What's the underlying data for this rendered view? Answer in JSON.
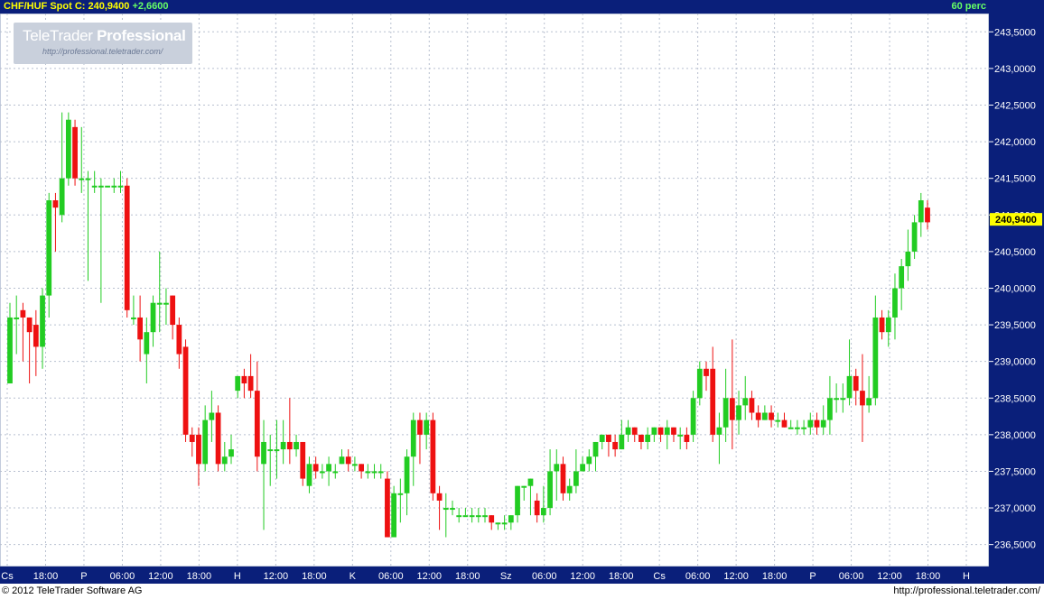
{
  "header": {
    "symbol": "CHF/HUF Spot",
    "close_label": "C:",
    "close_value": "240,9400",
    "change": "+2,6600",
    "period": "60 perc"
  },
  "watermark": {
    "brand_a": "TeleTrader",
    "brand_b": "Professional",
    "url": "http://professional.teletrader.com/"
  },
  "footer": {
    "copyright": "© 2012 TeleTrader Software AG",
    "url": "http://professional.teletrader.com/"
  },
  "colors": {
    "up": "#22cc22",
    "down": "#ee1111",
    "flat": "#22cccc",
    "header_bg": "#0a1f7a",
    "axis_bg": "#0a1f7a",
    "last_price_bg": "#ffff00"
  },
  "chart_data": {
    "type": "candlestick",
    "title": "CHF/HUF Spot",
    "y_range": [
      236.2,
      243.75
    ],
    "y_ticks": [
      "243,5000",
      "243,0000",
      "242,5000",
      "242,0000",
      "241,5000",
      "241,0000",
      "240,5000",
      "240,0000",
      "239,5000",
      "239,0000",
      "238,5000",
      "238,0000",
      "237,5000",
      "237,0000",
      "236,5000"
    ],
    "last_price_label": "240,9400",
    "last_price": 240.94,
    "x_ticks": [
      "Cs",
      "18:00",
      "P",
      "06:00",
      "12:00",
      "18:00",
      "H",
      "12:00",
      "18:00",
      "K",
      "06:00",
      "12:00",
      "18:00",
      "Sz",
      "06:00",
      "12:00",
      "18:00",
      "Cs",
      "06:00",
      "12:00",
      "18:00",
      "P",
      "06:00",
      "12:00",
      "18:00",
      "H"
    ],
    "grid": true,
    "candles": [
      [
        238.7,
        239.6,
        239.8,
        238.7
      ],
      [
        239.6,
        239.6,
        239.9,
        239.1
      ],
      [
        239.7,
        239.6,
        239.8,
        239.0
      ],
      [
        239.6,
        239.4,
        239.6,
        238.7
      ],
      [
        239.5,
        239.2,
        239.7,
        238.8
      ],
      [
        239.2,
        239.9,
        240.0,
        238.9
      ],
      [
        239.9,
        241.2,
        241.3,
        239.6
      ],
      [
        241.2,
        241.1,
        241.3,
        240.5
      ],
      [
        241.0,
        241.5,
        242.4,
        240.9
      ],
      [
        241.5,
        242.3,
        242.4,
        241.4
      ],
      [
        242.2,
        241.5,
        242.3,
        241.4
      ],
      [
        241.5,
        241.5,
        242.2,
        241.3
      ],
      [
        241.5,
        241.5,
        241.6,
        240.1
      ],
      [
        241.4,
        241.4,
        241.6,
        241.3
      ],
      [
        241.4,
        241.4,
        241.5,
        239.8
      ],
      [
        241.4,
        241.4,
        241.4,
        241.4
      ],
      [
        241.4,
        241.4,
        241.5,
        241.3
      ],
      [
        241.4,
        241.4,
        241.6,
        241.3
      ],
      [
        241.4,
        239.7,
        241.5,
        239.6
      ],
      [
        239.6,
        239.6,
        239.9,
        239.5
      ],
      [
        239.6,
        239.3,
        239.9,
        239.0
      ],
      [
        239.1,
        239.4,
        239.6,
        238.7
      ],
      [
        239.4,
        239.8,
        239.9,
        239.2
      ],
      [
        239.8,
        239.8,
        240.5,
        239.4
      ],
      [
        239.8,
        239.8,
        240.0,
        239.5
      ],
      [
        239.9,
        239.5,
        239.9,
        239.3
      ],
      [
        239.5,
        239.1,
        239.6,
        238.9
      ],
      [
        239.2,
        238.0,
        239.3,
        237.9
      ],
      [
        238.0,
        237.9,
        238.1,
        237.7
      ],
      [
        238.0,
        237.6,
        238.1,
        237.3
      ],
      [
        237.6,
        238.2,
        238.4,
        237.5
      ],
      [
        238.2,
        238.3,
        238.6,
        237.9
      ],
      [
        238.3,
        237.6,
        238.4,
        237.5
      ],
      [
        237.6,
        237.7,
        237.9,
        237.5
      ],
      [
        237.7,
        237.8,
        238.0,
        237.6
      ],
      [
        238.6,
        238.8,
        238.8,
        238.5
      ],
      [
        238.8,
        238.7,
        238.9,
        238.5
      ],
      [
        238.8,
        238.6,
        239.1,
        238.5
      ],
      [
        238.6,
        237.7,
        239.0,
        237.5
      ],
      [
        237.6,
        237.9,
        238.2,
        236.7
      ],
      [
        237.8,
        237.8,
        238.0,
        237.3
      ],
      [
        237.8,
        237.8,
        238.2,
        237.4
      ],
      [
        237.8,
        237.9,
        238.2,
        237.6
      ],
      [
        237.9,
        237.8,
        238.5,
        237.6
      ],
      [
        237.8,
        237.9,
        238.0,
        237.7
      ],
      [
        237.9,
        237.4,
        237.9,
        237.3
      ],
      [
        237.3,
        237.6,
        237.7,
        237.2
      ],
      [
        237.6,
        237.5,
        237.7,
        237.4
      ],
      [
        237.5,
        237.5,
        237.6,
        237.4
      ],
      [
        237.5,
        237.6,
        237.7,
        237.3
      ],
      [
        237.5,
        237.5,
        237.6,
        237.4
      ],
      [
        237.6,
        237.7,
        237.8,
        237.6
      ],
      [
        237.7,
        237.6,
        237.8,
        237.5
      ],
      [
        237.6,
        237.6,
        237.7,
        237.5
      ],
      [
        237.6,
        237.5,
        237.6,
        237.4
      ],
      [
        237.5,
        237.5,
        237.6,
        237.4
      ],
      [
        237.5,
        237.5,
        237.6,
        237.4
      ],
      [
        237.5,
        237.5,
        237.6,
        237.4
      ],
      [
        237.4,
        236.6,
        237.5,
        236.6
      ],
      [
        236.6,
        237.2,
        237.3,
        236.6
      ],
      [
        237.2,
        237.2,
        237.4,
        236.8
      ],
      [
        237.2,
        237.7,
        237.8,
        236.9
      ],
      [
        237.7,
        238.2,
        238.3,
        237.3
      ],
      [
        238.2,
        238.0,
        238.3,
        237.6
      ],
      [
        238.0,
        238.2,
        238.3,
        237.8
      ],
      [
        238.2,
        237.2,
        238.3,
        237.1
      ],
      [
        237.2,
        237.1,
        237.3,
        236.7
      ],
      [
        237.0,
        237.0,
        237.2,
        236.6
      ],
      [
        237.0,
        237.0,
        237.1,
        236.9
      ],
      [
        236.9,
        236.9,
        237.0,
        236.8
      ],
      [
        236.9,
        236.9,
        237.0,
        236.9
      ],
      [
        236.9,
        236.9,
        237.0,
        236.8
      ],
      [
        236.9,
        236.9,
        237.0,
        236.8
      ],
      [
        236.9,
        236.9,
        237.0,
        236.8
      ],
      [
        236.9,
        236.8,
        236.9,
        236.7
      ],
      [
        236.8,
        236.8,
        236.8,
        236.7
      ],
      [
        236.8,
        236.8,
        236.9,
        236.7
      ],
      [
        236.8,
        236.9,
        236.9,
        236.7
      ],
      [
        236.9,
        237.3,
        237.3,
        236.8
      ],
      [
        237.3,
        237.3,
        237.3,
        237.1
      ],
      [
        237.3,
        237.4,
        237.4,
        236.9
      ],
      [
        237.1,
        236.9,
        237.2,
        236.8
      ],
      [
        236.9,
        237.0,
        237.3,
        236.8
      ],
      [
        237.0,
        237.5,
        237.8,
        236.9
      ],
      [
        237.5,
        237.6,
        237.8,
        237.1
      ],
      [
        237.6,
        237.2,
        237.7,
        237.1
      ],
      [
        237.2,
        237.3,
        237.4,
        237.1
      ],
      [
        237.3,
        237.5,
        237.8,
        237.2
      ],
      [
        237.5,
        237.6,
        237.7,
        237.5
      ],
      [
        237.6,
        237.7,
        237.8,
        237.5
      ],
      [
        237.7,
        237.9,
        237.9,
        237.5
      ],
      [
        237.9,
        238.0,
        238.0,
        237.8
      ],
      [
        238.0,
        237.9,
        238.0,
        237.7
      ],
      [
        237.9,
        237.8,
        238.0,
        237.7
      ],
      [
        237.8,
        238.0,
        238.2,
        237.8
      ],
      [
        238.0,
        238.1,
        238.2,
        237.9
      ],
      [
        238.1,
        238.0,
        238.1,
        237.9
      ],
      [
        238.0,
        237.9,
        238.0,
        237.8
      ],
      [
        237.9,
        238.0,
        238.1,
        237.8
      ],
      [
        238.0,
        238.1,
        238.1,
        237.9
      ],
      [
        238.1,
        238.0,
        238.1,
        237.9
      ],
      [
        238.0,
        238.1,
        238.2,
        237.8
      ],
      [
        238.1,
        238.0,
        238.1,
        237.9
      ],
      [
        238.0,
        238.0,
        238.1,
        237.8
      ],
      [
        238.0,
        237.9,
        238.1,
        237.8
      ],
      [
        238.0,
        238.5,
        238.6,
        237.9
      ],
      [
        238.5,
        238.9,
        239.0,
        238.4
      ],
      [
        238.9,
        238.8,
        239.0,
        238.6
      ],
      [
        238.9,
        238.0,
        239.2,
        237.9
      ],
      [
        238.0,
        238.1,
        238.3,
        237.6
      ],
      [
        238.1,
        238.5,
        238.9,
        237.9
      ],
      [
        238.5,
        238.2,
        239.3,
        237.8
      ],
      [
        238.2,
        238.4,
        238.6,
        238.0
      ],
      [
        238.4,
        238.5,
        238.8,
        238.2
      ],
      [
        238.5,
        238.3,
        238.6,
        238.2
      ],
      [
        238.3,
        238.2,
        238.4,
        238.1
      ],
      [
        238.2,
        238.3,
        238.4,
        238.2
      ],
      [
        238.3,
        238.2,
        238.4,
        238.1
      ],
      [
        238.2,
        238.2,
        238.3,
        238.1
      ],
      [
        238.2,
        238.1,
        238.3,
        238.1
      ],
      [
        238.1,
        238.1,
        238.2,
        238.1
      ],
      [
        238.1,
        238.1,
        238.2,
        238.0
      ],
      [
        238.1,
        238.1,
        238.2,
        238.0
      ],
      [
        238.1,
        238.2,
        238.3,
        238.0
      ],
      [
        238.2,
        238.1,
        238.3,
        238.0
      ],
      [
        238.1,
        238.2,
        238.4,
        238.0
      ],
      [
        238.2,
        238.5,
        238.8,
        238.0
      ],
      [
        238.5,
        238.5,
        238.7,
        238.3
      ],
      [
        238.5,
        238.5,
        238.7,
        238.3
      ],
      [
        238.5,
        238.8,
        239.3,
        238.4
      ],
      [
        238.8,
        238.6,
        238.9,
        238.4
      ],
      [
        238.6,
        238.4,
        239.1,
        237.9
      ],
      [
        238.4,
        238.5,
        238.8,
        238.3
      ],
      [
        238.5,
        239.6,
        239.9,
        238.4
      ],
      [
        239.6,
        239.4,
        239.7,
        239.3
      ],
      [
        239.4,
        239.6,
        239.7,
        239.2
      ],
      [
        239.6,
        240.0,
        240.2,
        239.3
      ],
      [
        240.0,
        240.3,
        240.4,
        239.7
      ],
      [
        240.3,
        240.5,
        240.8,
        240.1
      ],
      [
        240.5,
        240.9,
        241.0,
        240.4
      ],
      [
        240.9,
        241.2,
        241.3,
        240.7
      ],
      [
        241.1,
        240.9,
        241.2,
        240.8
      ]
    ]
  }
}
